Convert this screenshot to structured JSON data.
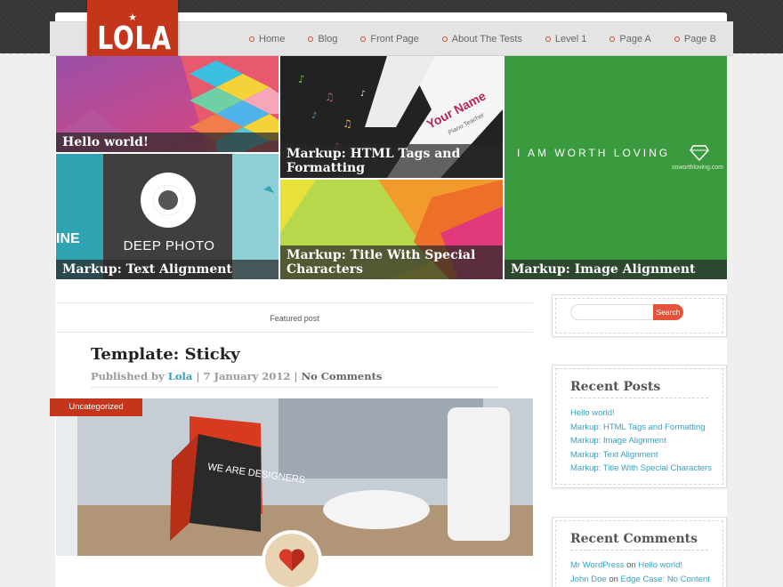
{
  "site": {
    "logo_text": "LOLA"
  },
  "nav": {
    "items": [
      {
        "label": "Home"
      },
      {
        "label": "Blog"
      },
      {
        "label": "Front Page"
      },
      {
        "label": "About The Tests"
      },
      {
        "label": "Level 1"
      },
      {
        "label": "Page A"
      },
      {
        "label": "Page B"
      }
    ]
  },
  "tiles": {
    "hello": {
      "caption": "Hello world!"
    },
    "html_tags": {
      "caption": "Markup: HTML Tags and Formatting",
      "card_name": "Your Name",
      "card_role": "Piano Teacher"
    },
    "worth_loving": {
      "caption": "Markup: Image Alignment",
      "text": "I AM WORTH LOVING",
      "url": "soworthloving.com"
    },
    "deep_photo": {
      "caption": "Markup: Text Alignment",
      "text": "DEEP PHOTO",
      "side_text": "INE"
    },
    "special_chars": {
      "caption": "Markup: Title With Special Characters"
    }
  },
  "main": {
    "featured_label": "Featured post",
    "post": {
      "title": "Template: Sticky",
      "published_by": "Published by",
      "author": "Lola",
      "date": "7 January 2012",
      "comments": "No Comments",
      "category": "Uncategorized",
      "image_text": "WE ARE DESIGNERS"
    }
  },
  "sidebar": {
    "search": {
      "placeholder": "",
      "button_label": "Search"
    },
    "recent_posts": {
      "title": "Recent Posts",
      "items": [
        "Hello world!",
        "Markup: HTML Tags and Formatting",
        "Markup: Image Alignment",
        "Markup: Text Alignment",
        "Markup: Title With Special Characters"
      ]
    },
    "recent_comments": {
      "title": "Recent Comments",
      "items": [
        {
          "author": "Mr WordPress",
          "on": "on",
          "post": "Hello world!"
        },
        {
          "author": "John Doe",
          "on": "on",
          "post": "Edge Case: No Content"
        }
      ]
    }
  },
  "colors": {
    "accent_red": "#c4361b",
    "link_blue": "#39a0c4",
    "green_tile": "#3a9b3e"
  }
}
